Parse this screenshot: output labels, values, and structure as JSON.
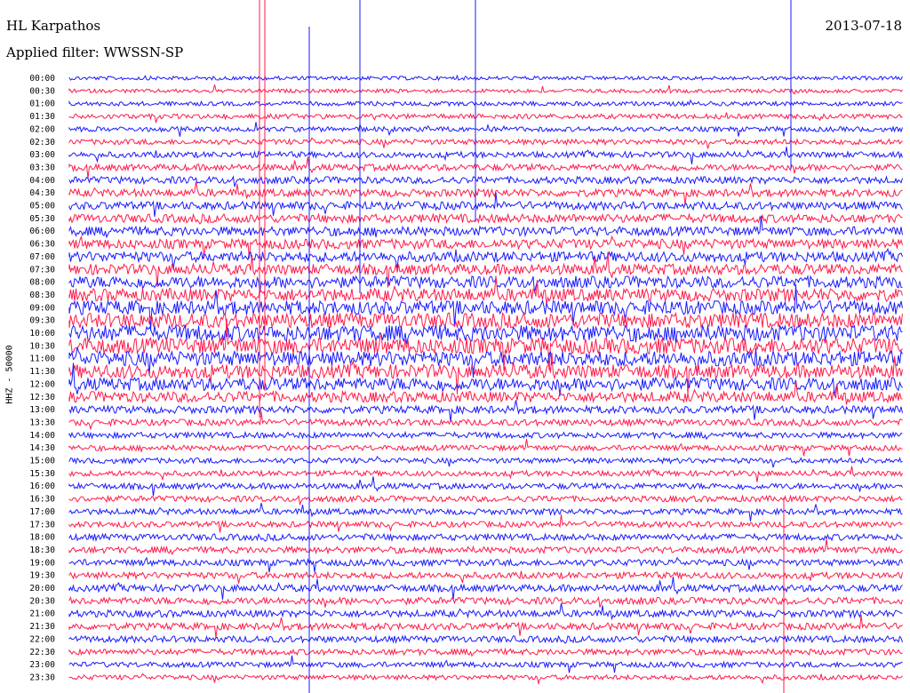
{
  "header": {
    "station": "HL Karpathos",
    "filter": "Applied filter: WWSSN-SP",
    "date": "2013-07-18",
    "channel": "HHZ - 50000"
  },
  "colors": {
    "trace_a": "#1a1aff",
    "trace_b": "#ff1a4a"
  },
  "chart_data": {
    "type": "helicorder",
    "title": "HL Karpathos",
    "subtitle": "Applied filter: WWSSN-SP",
    "ylabel": "HHZ - 50000",
    "date": "2013-07-18",
    "row_labels": [
      "00:00",
      "00:30",
      "01:00",
      "01:30",
      "02:00",
      "02:30",
      "03:00",
      "03:30",
      "04:00",
      "04:30",
      "05:00",
      "05:30",
      "06:00",
      "06:30",
      "07:00",
      "07:30",
      "08:00",
      "08:30",
      "09:00",
      "09:30",
      "10:00",
      "10:30",
      "11:00",
      "11:30",
      "12:00",
      "12:30",
      "13:00",
      "13:30",
      "14:00",
      "14:30",
      "15:00",
      "15:30",
      "16:00",
      "16:30",
      "17:00",
      "17:30",
      "18:00",
      "18:30",
      "19:00",
      "19:30",
      "20:00",
      "20:30",
      "21:00",
      "21:30",
      "22:00",
      "22:30",
      "23:00",
      "23:30"
    ],
    "row_minutes": 30,
    "series_colors": [
      "blue",
      "red"
    ],
    "relative_noise": [
      0.35,
      0.35,
      0.4,
      0.45,
      0.45,
      0.5,
      0.55,
      0.6,
      0.65,
      0.7,
      0.75,
      0.8,
      0.85,
      0.9,
      0.95,
      1.0,
      1.1,
      1.2,
      1.3,
      1.4,
      1.5,
      1.5,
      1.4,
      1.3,
      1.2,
      1.0,
      0.7,
      0.6,
      0.55,
      0.5,
      0.5,
      0.5,
      0.55,
      0.55,
      0.55,
      0.55,
      0.6,
      0.6,
      0.6,
      0.6,
      0.65,
      0.65,
      0.65,
      0.65,
      0.6,
      0.55,
      0.5,
      0.45
    ]
  }
}
